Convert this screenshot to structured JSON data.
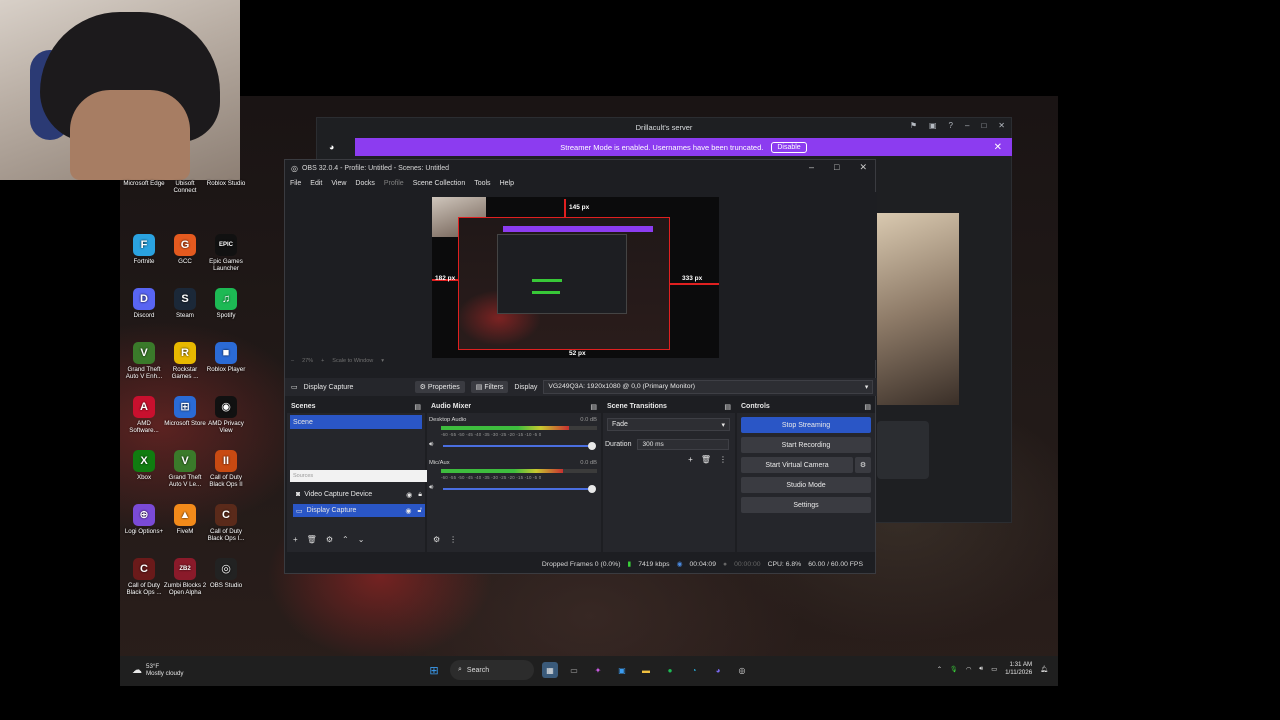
{
  "desktop_icons": [
    {
      "label": "Microsoft Edge",
      "glyph": "e",
      "color": "#1a73c8"
    },
    {
      "label": "Ubisoft Connect",
      "glyph": "U",
      "color": "#3252d6"
    },
    {
      "label": "Roblox Studio",
      "glyph": "R",
      "color": "#2b6bd6"
    },
    {
      "label": "Fortnite",
      "glyph": "F",
      "color": "#2aa2e0"
    },
    {
      "label": "GCC",
      "glyph": "G",
      "color": "#e45a1f"
    },
    {
      "label": "Epic Games Launcher",
      "glyph": "EPIC",
      "color": "#111111"
    },
    {
      "label": "Discord",
      "glyph": "D",
      "color": "#5865f2"
    },
    {
      "label": "Steam",
      "glyph": "S",
      "color": "#1b2838"
    },
    {
      "label": "Spotify",
      "glyph": "♫",
      "color": "#1db954"
    },
    {
      "label": "Grand Theft Auto V Enh...",
      "glyph": "V",
      "color": "#3a7a2a"
    },
    {
      "label": "Rockstar Games ...",
      "glyph": "R",
      "color": "#e8b800"
    },
    {
      "label": "Roblox Player",
      "glyph": "■",
      "color": "#2b6bd6"
    },
    {
      "label": "AMD Software...",
      "glyph": "A",
      "color": "#c8102e"
    },
    {
      "label": "Microsoft Store",
      "glyph": "⊞",
      "color": "#2a6bd6"
    },
    {
      "label": "AMD Privacy View",
      "glyph": "◉",
      "color": "#111111"
    },
    {
      "label": "Xbox",
      "glyph": "X",
      "color": "#107c10"
    },
    {
      "label": "Grand Theft Auto V Le...",
      "glyph": "V",
      "color": "#3a7a2a"
    },
    {
      "label": "Call of Duty Black Ops II",
      "glyph": "II",
      "color": "#c84a12"
    },
    {
      "label": "Logi Options+",
      "glyph": "⊕",
      "color": "#7a4ad6"
    },
    {
      "label": "FiveM",
      "glyph": "▲",
      "color": "#f28a1a"
    },
    {
      "label": "Call of Duty Black Ops I...",
      "glyph": "C",
      "color": "#5a2a1a"
    },
    {
      "label": "Call of Duty Black Ops ...",
      "glyph": "C",
      "color": "#6a1a1a"
    },
    {
      "label": "Zumbi Blocks 2 Open Alpha",
      "glyph": "ZB2",
      "color": "#8a1a2a"
    },
    {
      "label": "OBS Studio",
      "glyph": "◎",
      "color": "#222222"
    }
  ],
  "discord": {
    "server_title": "Drillacult's server",
    "banner_text": "Streamer Mode is enabled. Usernames have been truncated.",
    "disable_label": "Disable"
  },
  "obs": {
    "title": "OBS 32.0.4 - Profile: Untitled - Scenes: Untitled",
    "menu": [
      "File",
      "Edit",
      "View",
      "Docks",
      "Profile",
      "Scene Collection",
      "Tools",
      "Help"
    ],
    "measures": {
      "top": "145 px",
      "left": "182 px",
      "right": "333 px",
      "bottom": "52 px"
    },
    "zoom": {
      "percent": "27%",
      "scale_mode": "Scale to Window"
    },
    "source_toolbar": {
      "selected_source": "Display Capture",
      "properties_label": "Properties",
      "filters_label": "Filters",
      "display_label": "Display",
      "display_value": "VG249Q3A: 1920x1080 @ 0,0 (Primary Monitor)"
    },
    "scenes": {
      "title": "Scenes",
      "items": [
        "Scene"
      ]
    },
    "sources": {
      "header_placeholder": "Sources",
      "items": [
        {
          "label": "Video Capture Device",
          "selected": false
        },
        {
          "label": "Display Capture",
          "selected": true
        }
      ]
    },
    "audio_mixer": {
      "title": "Audio Mixer",
      "channels": [
        {
          "name": "Desktop Audio",
          "db": "0.0 dB",
          "level": 0.82
        },
        {
          "name": "Mic/Aux",
          "db": "0.0 dB",
          "level": 0.78
        }
      ],
      "ticks": "-60 -55 -50 -45 -40 -35 -30 -25 -20 -15 -10 -5 0"
    },
    "transitions": {
      "title": "Scene Transitions",
      "type": "Fade",
      "duration_label": "Duration",
      "duration_value": "300 ms"
    },
    "controls": {
      "title": "Controls",
      "buttons": [
        "Stop Streaming",
        "Start Recording",
        "Start Virtual Camera",
        "Studio Mode",
        "Settings"
      ]
    },
    "status": {
      "dropped_frames": "Dropped Frames 0 (0.0%)",
      "bitrate": "7419 kbps",
      "stream_time": "00:04:09",
      "record_time": "00:00:00",
      "cpu": "CPU: 6.8%",
      "fps": "60.00 / 60.00 FPS"
    }
  },
  "taskbar": {
    "weather_temp": "53°F",
    "weather_desc": "Mostly cloudy",
    "search_label": "Search",
    "time": "1:31 AM",
    "date": "1/11/2026"
  }
}
